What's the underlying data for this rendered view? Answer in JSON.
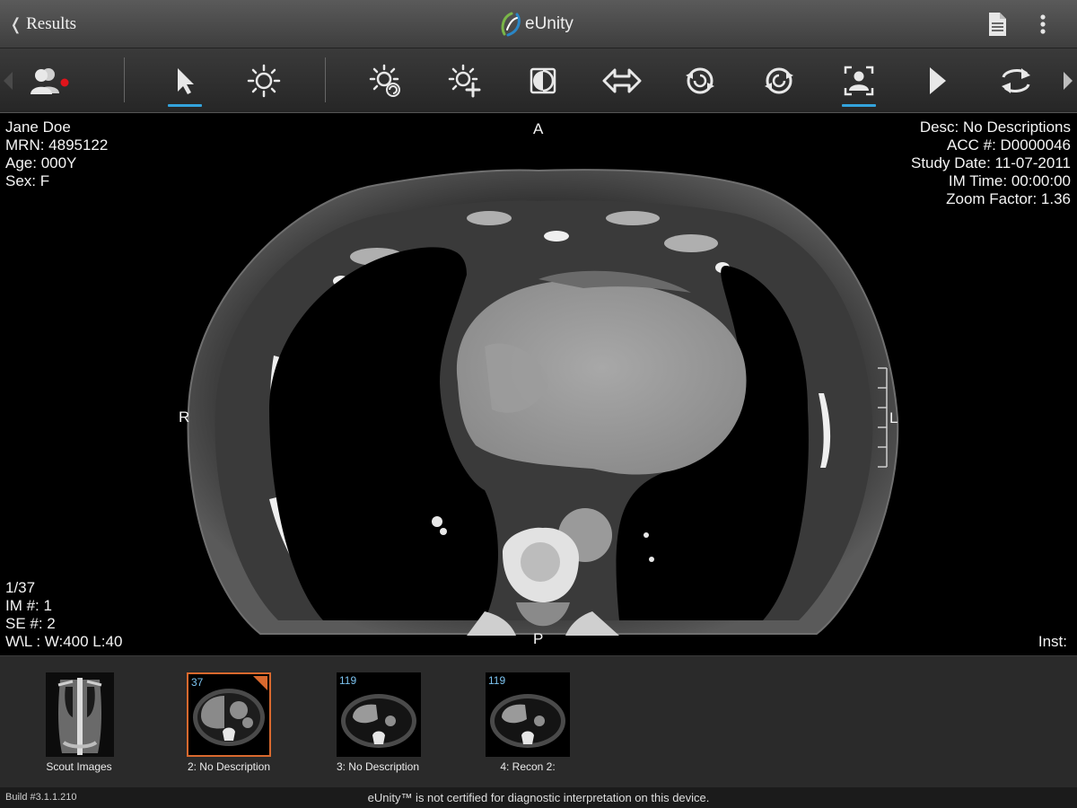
{
  "app": {
    "back_label": "Results",
    "logo_text": "eUnity"
  },
  "colors": {
    "accent": "#33a3dc",
    "selected_border": "#d9692e",
    "thumb_count": "#7cc3f0",
    "logo_green": "#7ab648",
    "logo_blue": "#2a86c6",
    "status_dot": "#e0141b"
  },
  "toolbar": {
    "tools": [
      {
        "name": "patients-icon",
        "active": false
      },
      {
        "name": "pointer-icon",
        "active": true
      },
      {
        "name": "window-level-icon",
        "active": false
      },
      {
        "name": "window-level-rotate-icon",
        "active": false
      },
      {
        "name": "window-level-add-icon",
        "active": false
      },
      {
        "name": "invert-icon",
        "active": false
      },
      {
        "name": "pan-icon",
        "active": false
      },
      {
        "name": "rotate-ccw-icon",
        "active": false
      },
      {
        "name": "rotate-cw-icon",
        "active": false
      },
      {
        "name": "fit-to-screen-icon",
        "active": true
      },
      {
        "name": "cine-play-icon",
        "active": false
      },
      {
        "name": "sync-icon",
        "active": false
      }
    ]
  },
  "overlay": {
    "patient_name": "Jane Doe",
    "mrn": "MRN: 4895122",
    "age": "Age: 000Y",
    "sex": "Sex: F",
    "desc": "Desc: No Descriptions",
    "acc": "ACC #: D0000046",
    "study_date": "Study Date: 11-07-2011",
    "im_time": "IM Time: 00:00:00",
    "zoom": "Zoom Factor: 1.36",
    "image_index": "1/37",
    "im_number": "IM #: 1",
    "se_number": "SE #: 2",
    "window_level": "W\\L : W:400 L:40",
    "inst": "Inst:",
    "orient_top": "A",
    "orient_bottom": "P",
    "orient_left": "R",
    "orient_right": "L"
  },
  "filmstrip": {
    "series": [
      {
        "label": "Scout Images",
        "count": "",
        "selected": false
      },
      {
        "label": "2: No Description",
        "count": "37",
        "selected": true
      },
      {
        "label": "3: No Description",
        "count": "119",
        "selected": false
      },
      {
        "label": "4: Recon 2:",
        "count": "119",
        "selected": false
      }
    ]
  },
  "footer": {
    "build": "Build #3.1.1.210",
    "disclaimer": "eUnity™ is not certified for diagnostic interpretation on this device."
  }
}
